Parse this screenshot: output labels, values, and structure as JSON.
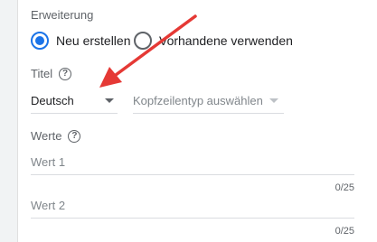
{
  "extension": {
    "label": "Erweiterung",
    "options": [
      {
        "label": "Neu erstellen",
        "checked": true
      },
      {
        "label": "Vorhandene verwenden",
        "checked": false
      }
    ]
  },
  "title_field": {
    "label": "Titel",
    "help_icon": "help-circle-icon",
    "language": "Deutsch",
    "header_type_placeholder": "Kopfzeilentyp auswählen"
  },
  "values_field": {
    "label": "Werte",
    "help_icon": "help-circle-icon",
    "items": [
      {
        "placeholder": "Wert 1",
        "counter": "0/25"
      },
      {
        "placeholder": "Wert 2",
        "counter": "0/25"
      }
    ]
  },
  "annotation": {
    "color": "#e53935"
  },
  "colors": {
    "accent": "#1a73e8"
  }
}
